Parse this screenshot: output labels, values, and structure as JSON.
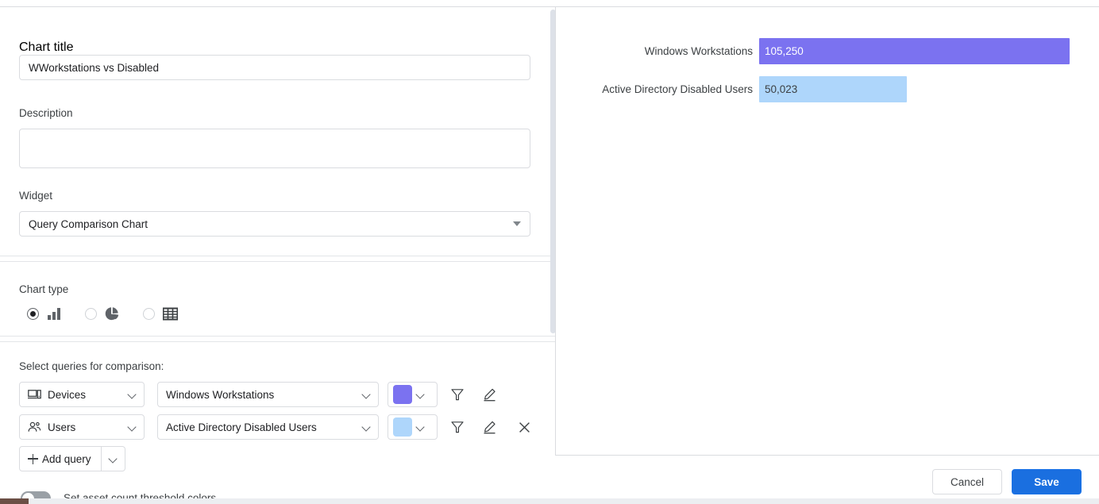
{
  "left_panel": {
    "chart_title": {
      "label": "Chart title",
      "value": "WWorkstations vs Disabled"
    },
    "description": {
      "label": "Description",
      "value": "",
      "placeholder": ""
    },
    "widget": {
      "label": "Widget",
      "value": "Query Comparison Chart"
    },
    "chart_type": {
      "label": "Chart type",
      "options": [
        {
          "icon": "bar-chart-icon",
          "selected": true
        },
        {
          "icon": "pie-chart-icon",
          "selected": false
        },
        {
          "icon": "table-grid-icon",
          "selected": false
        }
      ]
    },
    "queries": {
      "label": "Select queries for comparison:",
      "rows": [
        {
          "module_icon": "devices-icon",
          "module": "Devices",
          "query": "Windows Workstations",
          "color": "#7b72f0",
          "filter_icon": "funnel-icon",
          "edit_icon": "pencil-icon",
          "remove_icon": "",
          "removable": false
        },
        {
          "module_icon": "users-icon",
          "module": "Users",
          "query": "Active Directory Disabled Users",
          "color": "#aed6fb",
          "filter_icon": "funnel-icon",
          "edit_icon": "pencil-icon",
          "remove_icon": "close-x-icon",
          "removable": true
        }
      ],
      "add_query_label": "Add query",
      "add_query_plus_icon": "plus-icon",
      "add_query_caret_icon": "chevron-down-icon"
    },
    "threshold_toggle": {
      "label": "Set asset count threshold colors",
      "on": false
    }
  },
  "right_panel": {
    "footer": {
      "cancel_label": "Cancel",
      "save_label": "Save"
    }
  },
  "chart_data": {
    "type": "bar",
    "orientation": "horizontal",
    "title": "",
    "xlabel": "",
    "ylabel": "",
    "categories": [
      "Windows Workstations",
      "Active Directory Disabled Users"
    ],
    "values": [
      105250,
      50023
    ],
    "value_labels": [
      "105,250",
      "50,023"
    ],
    "colors": [
      "#7b72f0",
      "#aed6fb"
    ],
    "value_text_colors": [
      "#ffffff",
      "#3c4043"
    ],
    "xlim": [
      0,
      105250
    ],
    "grid": false,
    "legend": "none"
  },
  "colors": {
    "accent_blue": "#1a6fe0",
    "series_purple": "#7b72f0",
    "series_lightblue": "#aed6fb",
    "border": "#dadce0",
    "text": "#3c4043"
  }
}
